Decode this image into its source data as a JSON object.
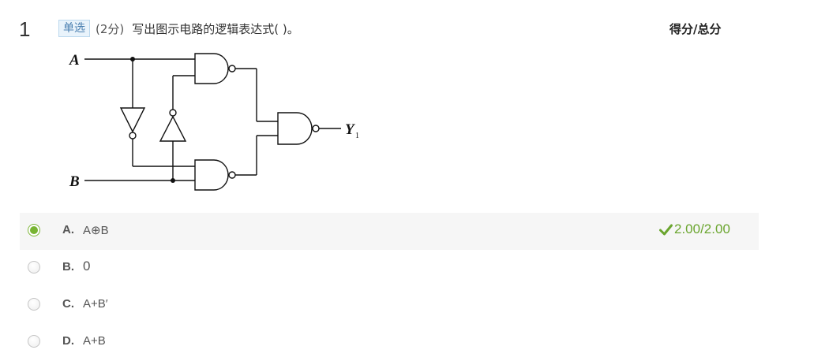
{
  "question": {
    "number": "1",
    "type_label": "单选",
    "score_text": "(2分)",
    "text": "写出图示电路的逻辑表达式(    )。",
    "score_header": "得分/总分"
  },
  "circuit": {
    "input_a": "A",
    "input_b": "B",
    "output": "Y",
    "output_subscript": "1"
  },
  "options": [
    {
      "letter": "A.",
      "text": "A⊕B",
      "selected": true
    },
    {
      "letter": "B.",
      "text": "0",
      "selected": false
    },
    {
      "letter": "C.",
      "text": "A+B′",
      "selected": false
    },
    {
      "letter": "D.",
      "text": "A+B",
      "selected": false
    }
  ],
  "result": {
    "icon": "check-icon",
    "score": "2.00/2.00",
    "color": "#6aa52e"
  }
}
